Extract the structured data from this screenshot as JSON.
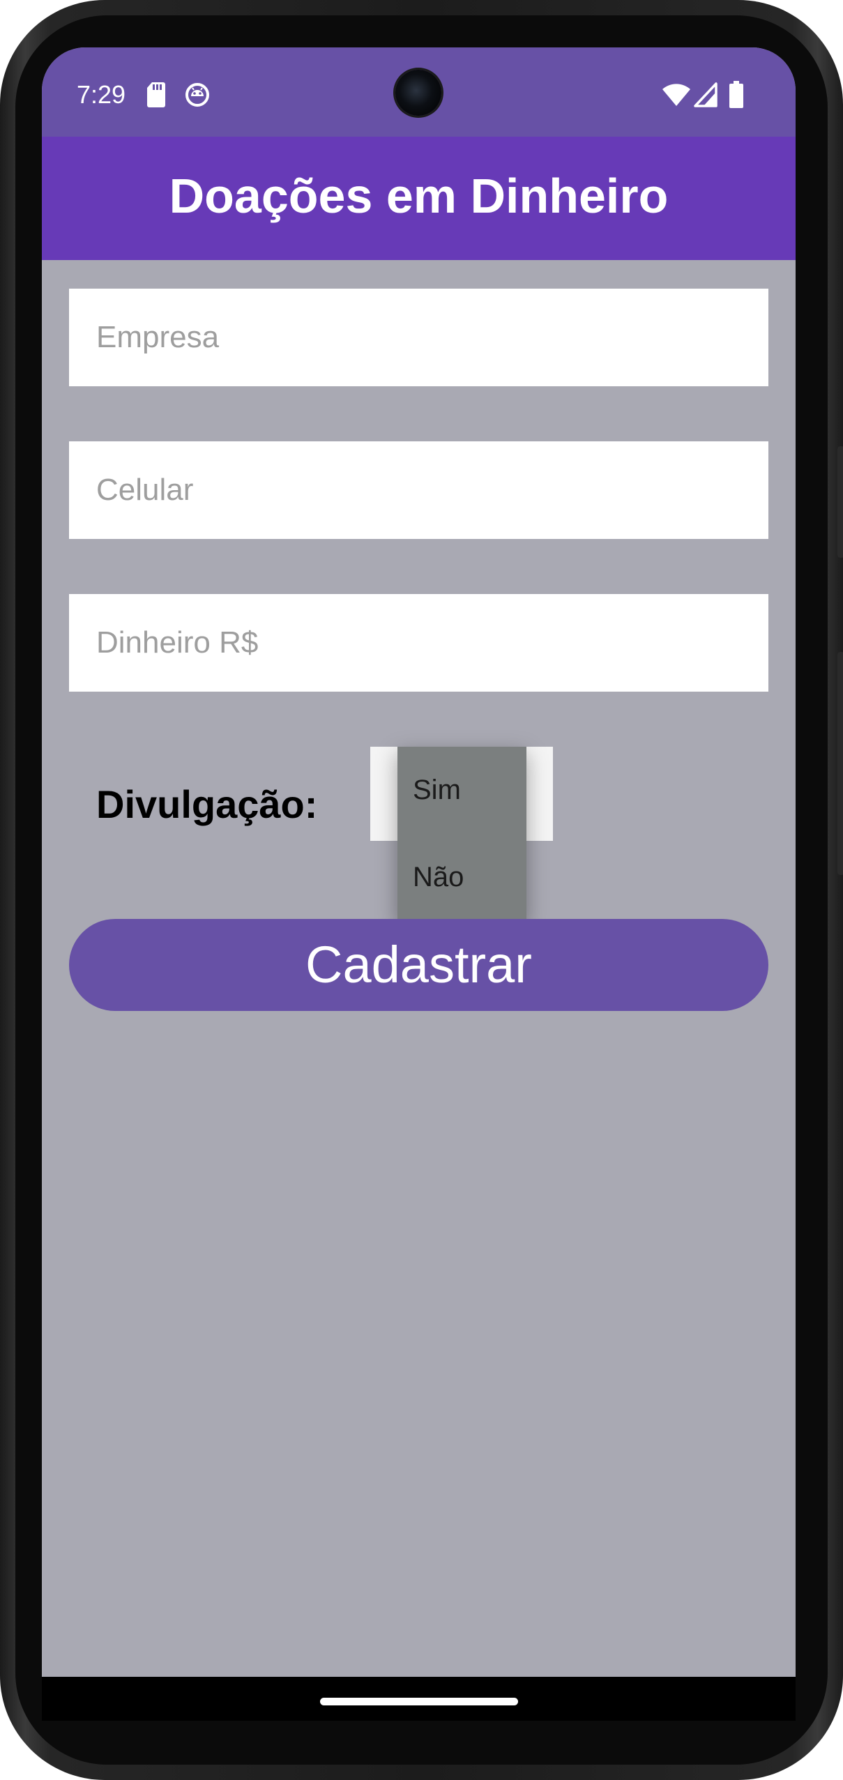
{
  "status_bar": {
    "time": "7:29",
    "left_icons": [
      "sd-card-icon",
      "android-debug-icon"
    ],
    "right_icons": [
      "wifi-icon",
      "cell-signal-icon",
      "battery-icon"
    ]
  },
  "app_bar": {
    "title": "Doações em Dinheiro"
  },
  "form": {
    "empresa": {
      "value": "",
      "placeholder": "Empresa"
    },
    "celular": {
      "value": "",
      "placeholder": "Celular"
    },
    "dinheiro": {
      "value": "",
      "placeholder": "Dinheiro R$"
    },
    "divulgacao_label": "Divulgação:",
    "divulgacao_options": [
      "Sim",
      "Não"
    ],
    "submit_label": "Cadastrar"
  },
  "colors": {
    "status_bar": "#6751a6",
    "app_bar": "#673ab7",
    "background": "#a9a9b3",
    "button": "#6751a6",
    "dropdown": "#7b7f7f"
  }
}
